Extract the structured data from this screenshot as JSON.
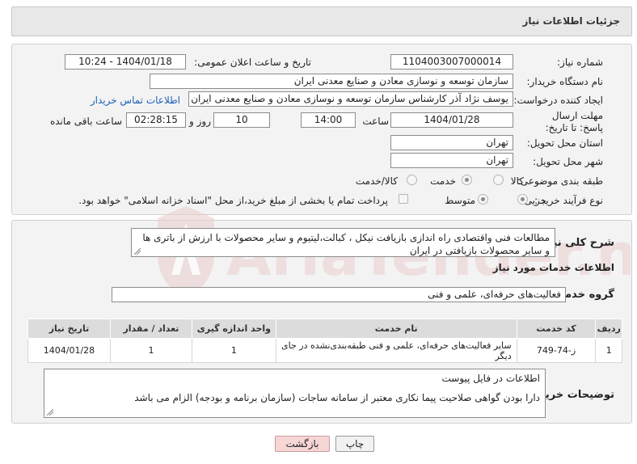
{
  "header": {
    "title": "جزئیات اطلاعات نیاز"
  },
  "form": {
    "need_number_label": "شماره نیاز:",
    "need_number": "1104003007000014",
    "announce_label": "تاریخ و ساعت اعلان عمومی:",
    "announce_value": "1404/01/18 - 10:24",
    "buyer_org_label": "نام دستگاه خریدار:",
    "buyer_org": "سازمان توسعه و نوسازی معادن و صنایع معدنی ایران",
    "requester_label": "ایجاد کننده درخواست:",
    "requester": "یوسف نژاد آذر کارشناس سازمان توسعه و نوسازی معادن و صنایع معدنی ایران",
    "buyer_contact_link": "اطلاعات تماس خریدار",
    "deadline_label": "مهلت ارسال پاسخ: تا تاریخ:",
    "deadline_date": "1404/01/28",
    "time_label": "ساعت",
    "deadline_time": "14:00",
    "days_value": "10",
    "days_label": "روز و",
    "remaining_time": "02:28:15",
    "remaining_label": "ساعت باقی مانده",
    "province_label": "استان محل تحویل:",
    "province": "تهران",
    "city_label": "شهر محل تحویل:",
    "city": "تهران",
    "category_label": "طبقه بندی موضوعی:",
    "category_options": [
      "کالا",
      "خدمت",
      "کالا/خدمت"
    ],
    "process_label": "نوع فرآیند خرید :",
    "process_options": [
      "جزیی",
      "متوسط"
    ],
    "payment_note": "پرداخت تمام یا بخشی از مبلغ خرید،از محل \"اسناد خزانه اسلامی\" خواهد بود."
  },
  "description": {
    "label": "شرح کلی نیاز:",
    "text": "مطالعات فنی واقتصادی راه اندازی بازیافت نیکل ، کبالت،لیتیوم و سایر محصولات با ارزش از باتری ها و سایر محصولات بازیافتی در ایران"
  },
  "services": {
    "section_title": "اطلاعات خدمات مورد نیاز",
    "group_label": "گروه خدمت:",
    "group_value": "فعالیت‌های حرفه‌ای، علمی و فنی",
    "columns": [
      "ردیف",
      "کد خدمت",
      "نام خدمت",
      "واحد اندازه گیری",
      "تعداد / مقدار",
      "تاریخ نیاز"
    ],
    "rows": [
      [
        "1",
        "ز-74-749",
        "سایر فعالیت‌های حرفه‌ای، علمی و فنی طبقه‌بندی‌نشده در جای دیگر",
        "1",
        "1",
        "1404/01/28"
      ]
    ]
  },
  "buyer_notes": {
    "label": "توضیحات خریدار:",
    "line1": "اطلاعات در فایل پیوست",
    "line2": "دارا بودن گواهی صلاحیت پیما نکاری  معتبر از سامانه ساجات (سازمان برنامه و بودجه) الزام می باشد"
  },
  "buttons": {
    "print": "چاپ",
    "back": "بازگشت"
  },
  "watermark": {
    "text": "AriaTender.neT"
  },
  "colors": {
    "link": "#1b5fb8",
    "back_button_bg": "#f7d6d6",
    "watermark": "#e8c7c7"
  }
}
